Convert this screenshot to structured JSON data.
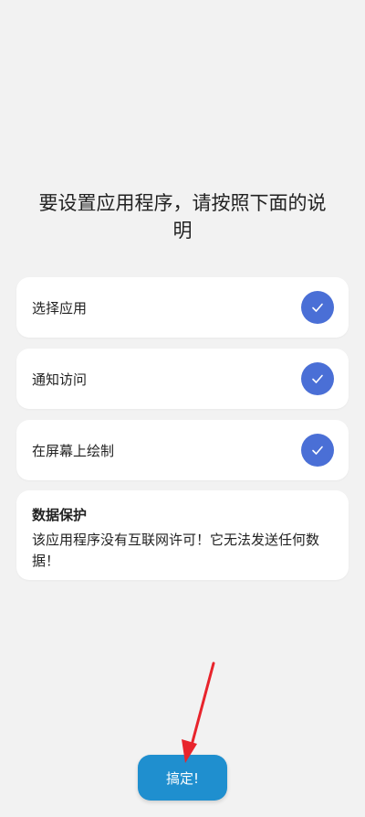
{
  "heading": "要设置应用程序，请按照下面的说明",
  "steps": [
    {
      "label": "选择应用",
      "checked": true,
      "icon": "check-icon"
    },
    {
      "label": "通知访问",
      "checked": true,
      "icon": "check-icon"
    },
    {
      "label": "在屏幕上绘制",
      "checked": true,
      "icon": "check-icon"
    }
  ],
  "privacy": {
    "title": "数据保护",
    "text": "该应用程序没有互联网许可！它无法发送任何数据！"
  },
  "done_button": {
    "label": "搞定!"
  },
  "colors": {
    "background": "#f2f2f2",
    "check_accent": "#4a6fd6",
    "button": "#1f8fcf",
    "annotation_arrow": "#e8242c"
  }
}
